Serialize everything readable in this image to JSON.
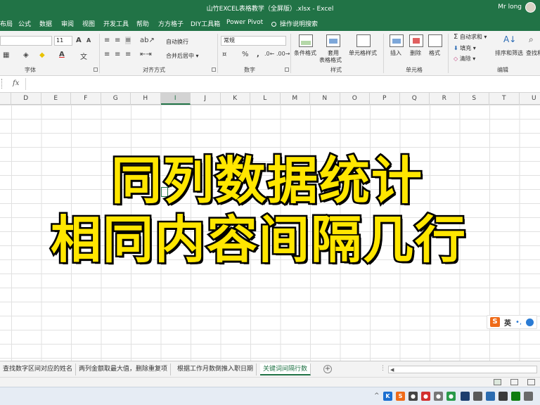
{
  "title_bar": {
    "document_title": "山竹EXCEL表格教学（全屏版）.xlsx  -  Excel",
    "user": "Mr long"
  },
  "tabs": [
    "布局",
    "公式",
    "数据",
    "审阅",
    "视图",
    "开发工具",
    "帮助",
    "方方格子",
    "DIY工具箱",
    "Power Pivot"
  ],
  "tell_me": "操作说明搜索",
  "ribbon": {
    "font_size": "11",
    "font_grow": "A",
    "font_shrink": "A",
    "font_color_glyph": "A",
    "wrap_text": "自动换行",
    "merge_center": "合并后居中",
    "number_format": "常规",
    "percent": "%",
    "comma": ",",
    "conditional_format": "条件格式",
    "table_format_1": "套用",
    "table_format_2": "表格格式",
    "cell_styles": "单元格样式",
    "insert": "插入",
    "delete": "删除",
    "format": "格式",
    "autosum": "自动求和",
    "fill": "填充",
    "clear": "清除",
    "sort_filter": "排序和筛选",
    "find_select": "查找和",
    "group_labels": {
      "font": "字体",
      "alignment": "对齐方式",
      "number": "数字",
      "styles": "样式",
      "cells": "单元格",
      "editing": "编辑"
    }
  },
  "formula_bar": {
    "fx": "fx",
    "value": ""
  },
  "columns": [
    "D",
    "E",
    "F",
    "G",
    "H",
    "I",
    "J",
    "K",
    "L",
    "M",
    "N",
    "O",
    "P",
    "Q",
    "R",
    "S",
    "T",
    "U"
  ],
  "selected_column": "I",
  "overlay": {
    "line1": "同列数据统计",
    "line2": "相同内容间隔几行"
  },
  "ime": {
    "logo": "S",
    "mode": "英",
    "punct": "•,"
  },
  "sheet_tabs": [
    {
      "label": "查找数字区间对应的姓名",
      "active": false
    },
    {
      "label": "两列金额取最大值，删除重复项",
      "active": false
    },
    {
      "label": "根据工作月数倒推入职日期",
      "active": false
    },
    {
      "label": "关键词间隔行数",
      "active": true
    }
  ],
  "add_sheet": "+",
  "colors": {
    "excel_green": "#217346",
    "overlay_yellow": "#ffe600"
  },
  "tray_icons": [
    "K",
    "S",
    "●",
    "●",
    "●",
    "●"
  ]
}
